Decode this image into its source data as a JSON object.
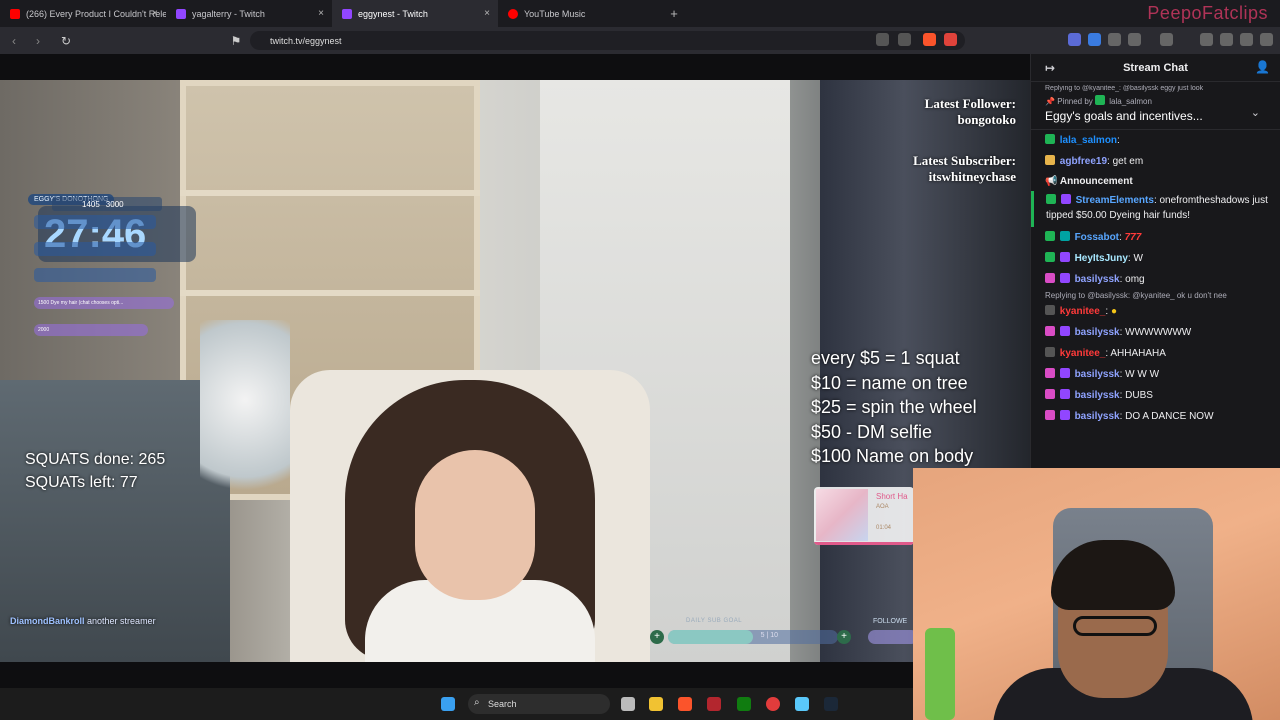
{
  "browser": {
    "tabs": [
      {
        "title": "(266) Every Product I Couldn't Relea",
        "color": "#ff0000"
      },
      {
        "title": "yagalterry - Twitch",
        "color": "#9146ff"
      },
      {
        "title": "eggynest - Twitch",
        "color": "#9146ff",
        "active": true
      },
      {
        "title": "YouTube Music",
        "color": "#ff0000"
      }
    ],
    "new_tab": "+",
    "close_icon": "×",
    "url": "twitch.tv/eggynest",
    "watermark": "PeepoFatclips"
  },
  "stream_overlay": {
    "timer_label": "EGGY'S DONOTHONG",
    "timer": "27:46",
    "counter_current": "1405",
    "counter_goal": "3000",
    "chip_1_label": "Dye my hair (chat chooses opti...",
    "chip_1_amount": "1500",
    "chip_2_amount": "2000",
    "squats_done": "SQUATS done: 265",
    "squats_left": "SQUATs left: 77",
    "latest_follower_label": "Latest Follower:",
    "latest_follower": "bongotoko",
    "latest_subscriber_label": "Latest Subscriber:",
    "latest_subscriber": "itswhitneychase",
    "incentives": [
      "every $5 = 1 squat",
      "$10 = name on tree",
      "$25 = spin the wheel",
      "$50 - DM selfie",
      "$100 Name on body"
    ],
    "music_title": "Short Ha",
    "music_artist": "AOA",
    "music_time": "01:04",
    "sub_goal_label": "DAILY SUB GOAL",
    "sub_goal_progress": "5 | 10",
    "sub_goal_fraction": 0.5,
    "follower_goal_label": "FOLLOWE",
    "raid_name": "DiamondBankroll",
    "raid_text": "another streamer"
  },
  "chat": {
    "header": "Stream Chat",
    "pinned_reply": "Replying to @kyanitee_: @basilyssk eggy just look",
    "pinned_by": "Pinned by",
    "pinned_by_user": "lala_salmon",
    "pinned_message": "Eggy's goals and incentives...",
    "messages": [
      {
        "name": "lala_salmon",
        "color": "#1e90ff",
        "text": ":"
      },
      {
        "name": "agbfree19",
        "color": "#8fa3ff",
        "text": ": get em"
      }
    ],
    "announcement_label": "Announcement",
    "announcement_name": "StreamElements",
    "announcement_text": ": onefromtheshadows just tipped $50.00",
    "announcement_tail": "Dyeing hair funds!",
    "messages2": [
      {
        "name": "Fossabot",
        "color": "#58a6ff",
        "text": ":"
      },
      {
        "name": "HeyItsJuny",
        "color": "#a8e8ff",
        "text": ": W"
      },
      {
        "name": "basilyssk",
        "color": "#8fa3ff",
        "text": ": omg"
      }
    ],
    "reply_line": "Replying to @basilyssk: @kyanitee_ ok u don't nee",
    "messages3": [
      {
        "name": "kyanitee_",
        "color": "#ff3a3a",
        "text": ":"
      },
      {
        "name": "basilyssk",
        "color": "#8fa3ff",
        "text": ": WWWWWWW"
      },
      {
        "name": "kyanitee_",
        "color": "#ff3a3a",
        "text": ": AHHAHAHA"
      },
      {
        "name": "basilyssk",
        "color": "#8fa3ff",
        "text": ": W W W"
      },
      {
        "name": "basilyssk",
        "color": "#8fa3ff",
        "text": ": DUBS"
      },
      {
        "name": "basilyssk",
        "color": "#8fa3ff",
        "text": ": DO A DANCE NOW"
      }
    ]
  },
  "taskbar": {
    "search_placeholder": "Search"
  },
  "colors": {
    "twitch_purple": "#9146ff",
    "chat_bg": "#18181b",
    "announcement_green": "#1fb455"
  }
}
